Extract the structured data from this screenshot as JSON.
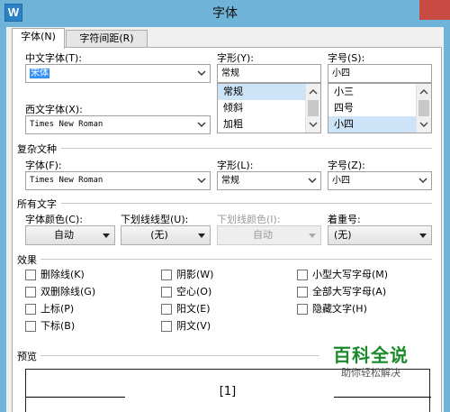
{
  "window": {
    "title": "字体",
    "app_icon_letter": "W"
  },
  "tabs": [
    {
      "label": "字体(N)"
    },
    {
      "label": "字符间距(R)"
    }
  ],
  "font": {
    "chinese_label": "中文字体(T):",
    "chinese_value": "宋体",
    "western_label": "西文字体(X):",
    "western_value": "Times New Roman",
    "style_label": "字形(Y):",
    "style_value": "常规",
    "style_options": [
      "常规",
      "倾斜",
      "加粗"
    ],
    "size_label": "字号(S):",
    "size_value": "小四",
    "size_options": [
      "小三",
      "四号",
      "小四"
    ]
  },
  "complex": {
    "section_label": "复杂文种",
    "font_label": "字体(F):",
    "font_value": "Times New Roman",
    "style_label": "字形(L):",
    "style_value": "常规",
    "size_label": "字号(Z):",
    "size_value": "小四"
  },
  "all_text": {
    "section_label": "所有文字",
    "color_label": "字体颜色(C):",
    "color_value": "自动",
    "underline_type_label": "下划线线型(U):",
    "underline_type_value": "(无)",
    "underline_color_label": "下划线颜色(I):",
    "underline_color_value": "自动",
    "emphasis_label": "着重号:",
    "emphasis_value": "(无)"
  },
  "effects": {
    "section_label": "效果",
    "col1": [
      "删除线(K)",
      "双删除线(G)",
      "上标(P)",
      "下标(B)"
    ],
    "col2": [
      "阴影(W)",
      "空心(O)",
      "阳文(E)",
      "阴文(V)"
    ],
    "col3": [
      "小型大写字母(M)",
      "全部大写字母(A)",
      "隐藏文字(H)"
    ]
  },
  "preview": {
    "section_label": "预览",
    "sample_text": "[1]"
  },
  "watermark": {
    "main": "百科全说",
    "sub": "助你轻松解决"
  },
  "colors": {
    "title_bar": "#6fb3d8",
    "close_button": "#c74a43",
    "selection": "#3390ff",
    "list_selected": "#cde3f7",
    "watermark": "#1a8a2a"
  }
}
